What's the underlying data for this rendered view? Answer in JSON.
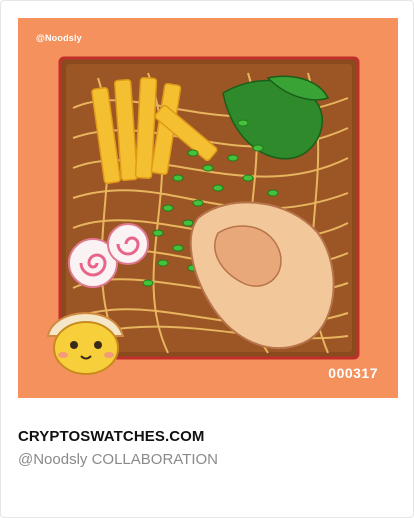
{
  "card": {
    "artwork": {
      "watermark_handle": "@Noodsly",
      "token_number": "000317",
      "description_icon": "ramen-bowl-illustration",
      "background_color": "#f5915c"
    },
    "title": "CRYPTOSWATCHES.COM",
    "subtitle": "@Noodsly COLLABORATION"
  }
}
